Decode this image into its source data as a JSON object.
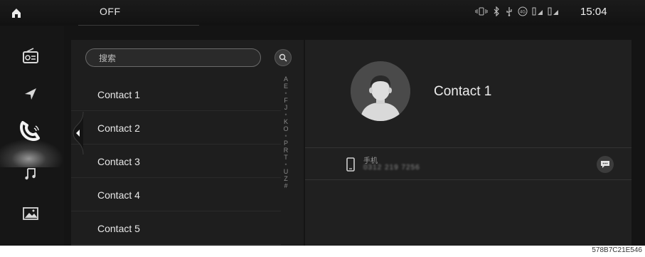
{
  "status_bar": {
    "state": "OFF",
    "clock": "15:04",
    "icons": [
      "vibrate-icon",
      "bluetooth-icon",
      "usb-icon",
      "4g-icon",
      "signal-1-icon",
      "signal-2-icon"
    ],
    "network_label": "4G"
  },
  "rail": {
    "items": [
      {
        "icon": "radio-icon"
      },
      {
        "icon": "navigation-icon"
      },
      {
        "icon": "phone-icon",
        "active": true
      },
      {
        "icon": "music-icon"
      },
      {
        "icon": "gallery-icon"
      }
    ]
  },
  "contacts": {
    "search_placeholder": "搜索",
    "items": [
      "Contact 1",
      "Contact 2",
      "Contact 3",
      "Contact 4",
      "Contact 5"
    ],
    "alphabet": [
      "A",
      "E",
      "•",
      "F",
      "J",
      "•",
      "K",
      "O",
      "•",
      "P",
      "R",
      "T",
      "•",
      "U",
      "Z",
      "#"
    ]
  },
  "detail": {
    "name": "Contact 1",
    "phone_label": "手机",
    "phone_number": "0312 219 7256"
  },
  "caption": "578B7C21E546",
  "colors": {
    "background": "#141414",
    "panel": "#1e1e1e",
    "detail_panel": "#202020",
    "text": "#e8e8e8"
  }
}
